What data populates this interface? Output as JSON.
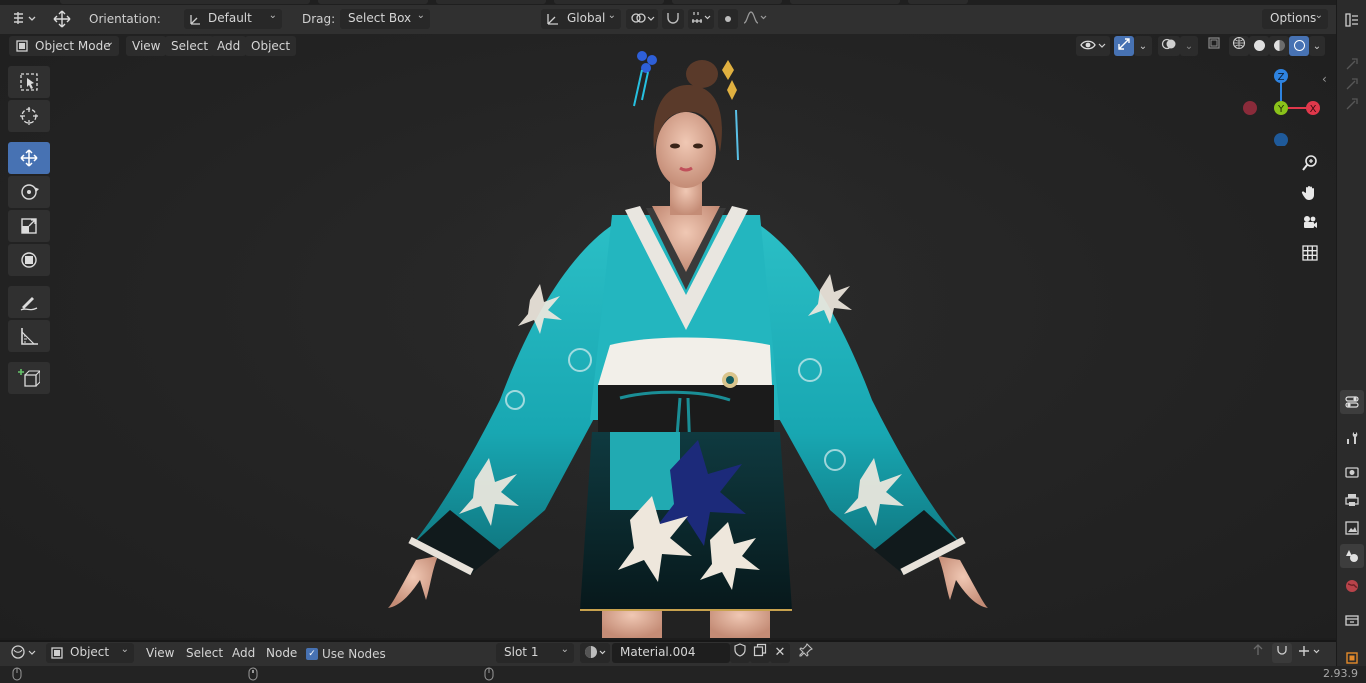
{
  "tool_header": {
    "orientation_label": "Orientation:",
    "orientation_value": "Default",
    "drag_label": "Drag:",
    "drag_value": "Select Box",
    "transform_orientation": "Global",
    "options_label": "Options"
  },
  "viewport_header": {
    "mode": "Object Mode",
    "menus": [
      "View",
      "Select",
      "Add",
      "Object"
    ]
  },
  "toolbar": {
    "tools": [
      "select-box",
      "cursor",
      "move",
      "rotate",
      "scale",
      "transform",
      "annotate",
      "measure",
      "add-cube"
    ],
    "active_tool": "move"
  },
  "gizmo": {
    "axes": [
      "Z",
      "Y",
      "X"
    ],
    "colors": {
      "x": "#e0384b",
      "y": "#8ac21a",
      "z": "#2e83e0"
    }
  },
  "navigation": [
    "zoom-icon",
    "hand-icon",
    "camera-icon",
    "grid-icon"
  ],
  "node_header": {
    "editor_type": "Object",
    "menus": [
      "View",
      "Select",
      "Add",
      "Node"
    ],
    "use_nodes_label": "Use Nodes",
    "use_nodes_checked": true,
    "slot": "Slot 1",
    "material": "Material.004"
  },
  "status": {
    "version": "2.93.9"
  },
  "colors": {
    "accent": "#4772b3",
    "header_bg": "#303030",
    "viewport_bg": "#232323"
  }
}
